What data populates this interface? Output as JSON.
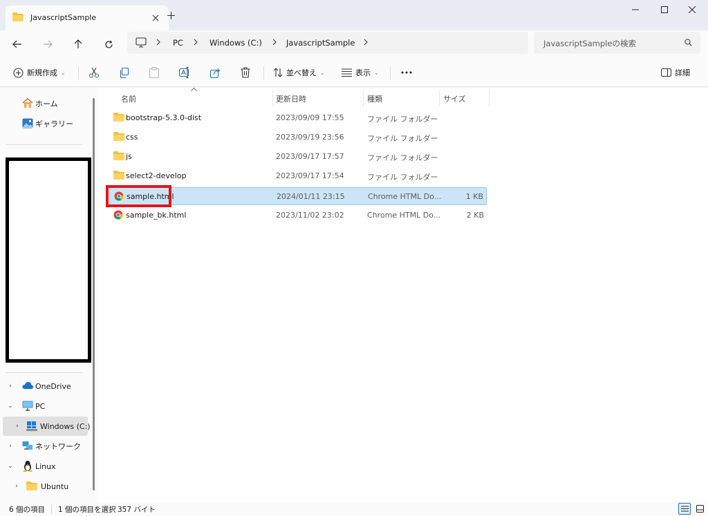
{
  "window": {
    "tab_title": "JavascriptSample",
    "colors": {
      "titlebar": "#e9edf3",
      "selection": "#cce4f7",
      "highlight_box": "#e0161b",
      "folder": "#f5c042"
    }
  },
  "address": {
    "breadcrumb": [
      "PC",
      "Windows (C:)",
      "JavascriptSample"
    ],
    "search_placeholder": "JavascriptSampleの検索"
  },
  "toolbar": {
    "new_label": "新規作成",
    "sort_label": "並べ替え",
    "view_label": "表示",
    "details_label": "詳細"
  },
  "sidebar": {
    "top_items": [
      {
        "label": "ホーム",
        "icon": "home-icon"
      },
      {
        "label": "ギャラリー",
        "icon": "gallery-icon"
      }
    ],
    "tree": [
      {
        "label": "OneDrive",
        "icon": "cloud-icon",
        "arrow": "›"
      },
      {
        "label": "PC",
        "icon": "pc-icon",
        "arrow": "⌄"
      },
      {
        "label": "Windows (C:)",
        "icon": "drive-icon",
        "arrow": "›"
      },
      {
        "label": "ネットワーク",
        "icon": "network-icon",
        "arrow": "›"
      },
      {
        "label": "Linux",
        "icon": "linux-icon",
        "arrow": "⌄"
      },
      {
        "label": "Ubuntu",
        "icon": "folder-icon",
        "arrow": "›"
      }
    ]
  },
  "columns": {
    "name": "名前",
    "modified": "更新日時",
    "type": "種類",
    "size": "サイズ"
  },
  "files": [
    {
      "name": "bootstrap-5.3.0-dist",
      "modified": "2023/09/09 17:55",
      "type": "ファイル フォルダー",
      "size": "",
      "icon": "folder-icon"
    },
    {
      "name": "css",
      "modified": "2023/09/19 23:56",
      "type": "ファイル フォルダー",
      "size": "",
      "icon": "folder-icon"
    },
    {
      "name": "js",
      "modified": "2023/09/17 17:57",
      "type": "ファイル フォルダー",
      "size": "",
      "icon": "folder-icon"
    },
    {
      "name": "select2-develop",
      "modified": "2023/09/17 17:54",
      "type": "ファイル フォルダー",
      "size": "",
      "icon": "folder-icon"
    },
    {
      "name": "sample.html",
      "modified": "2024/01/11 23:15",
      "type": "Chrome HTML Do...",
      "size": "1 KB",
      "icon": "chrome-icon",
      "selected": true
    },
    {
      "name": "sample_bk.html",
      "modified": "2023/11/02 23:02",
      "type": "Chrome HTML Do...",
      "size": "2 KB",
      "icon": "chrome-icon"
    }
  ],
  "status": {
    "item_count": "6 個の項目",
    "selection": "1 個の項目を選択",
    "selection_size": "357 バイト"
  }
}
